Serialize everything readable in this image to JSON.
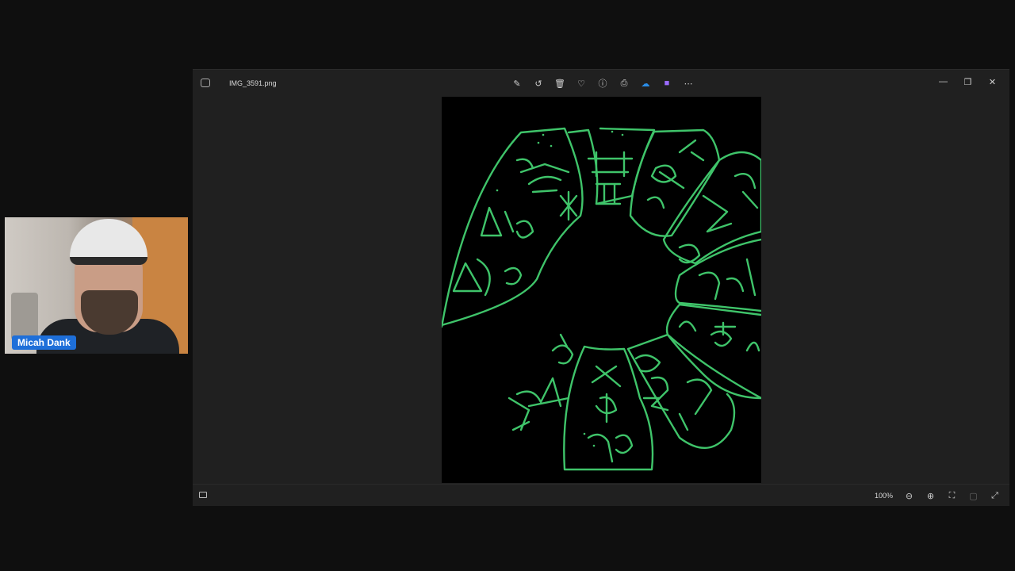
{
  "webcam": {
    "participant_name": "Micah Dank"
  },
  "window": {
    "file_name": "IMG_3591.png",
    "toolbar": [
      {
        "name": "edit-image-icon",
        "glyph": "✎"
      },
      {
        "name": "rotate-icon",
        "glyph": "↺"
      },
      {
        "name": "delete-icon",
        "glyph": "🗑"
      },
      {
        "name": "favorite-icon",
        "glyph": "♡"
      },
      {
        "name": "info-icon",
        "glyph": "ⓘ"
      },
      {
        "name": "print-icon",
        "glyph": "⎙"
      },
      {
        "name": "onedrive-icon",
        "glyph": "☁"
      },
      {
        "name": "clipchamp-icon",
        "glyph": "■"
      },
      {
        "name": "more-options-icon",
        "glyph": "⋯"
      }
    ],
    "controls": {
      "minimize": "—",
      "restore": "❐",
      "close": "✕"
    },
    "zoom": {
      "level": "100%",
      "zoom_out": "⊖",
      "zoom_in": "⊕",
      "fit": "⛶",
      "actual_size": "▢",
      "fullscreen": "⤢"
    }
  },
  "colors": {
    "glyph_green": "#3fc46a",
    "name_tag_blue": "#1e6fd9",
    "window_bg": "#202020"
  }
}
